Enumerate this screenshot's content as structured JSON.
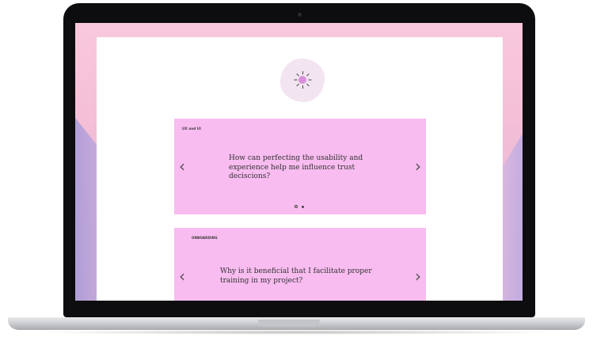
{
  "cards": [
    {
      "category": "UX and UI",
      "question": "How can perfecting the usability and experience help me influence trust deciscions?",
      "prev_icon": "chevron-left-icon",
      "next_icon": "chevron-right-icon",
      "pagination": {
        "current": 1,
        "total": 2
      }
    },
    {
      "category": "ONBOARDING",
      "question": "Why is it beneficial that I facilitate proper training in my project?",
      "prev_icon": "chevron-left-icon",
      "next_icon": "chevron-right-icon"
    }
  ],
  "glyphs": {
    "prev": "‹",
    "next": "›"
  },
  "colors": {
    "card_bg": "#f8bcf0",
    "hero_blob": "#f3e4f1",
    "sun": "#d98fd9",
    "wallpaper": "#f4bfd7"
  },
  "hero_icon": "sun-icon"
}
